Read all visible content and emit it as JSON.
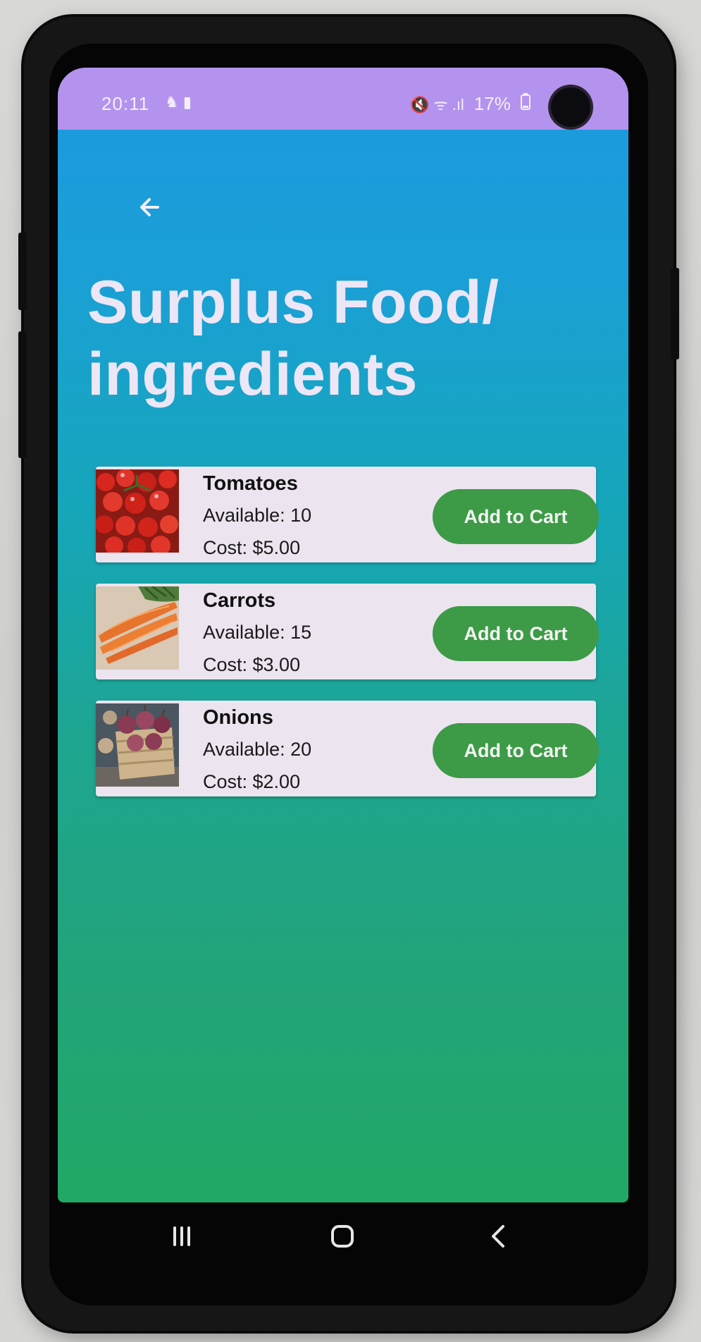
{
  "status_bar": {
    "time": "20:11",
    "left_icons": "♞ ▮",
    "right_icons": "🔇 ᯤ .ıl",
    "battery": "17%",
    "color": "#b493ee"
  },
  "header": {
    "back_icon": "arrow-left-icon",
    "title": "Surplus Food/ ingredients"
  },
  "items": [
    {
      "name": "Tomatoes",
      "available": "Available: 10",
      "cost": "Cost: $5.00",
      "button": "Add to Cart",
      "image": "tomatoes-photo"
    },
    {
      "name": "Carrots",
      "available": "Available: 15",
      "cost": "Cost: $3.00",
      "button": "Add to Cart",
      "image": "carrots-photo"
    },
    {
      "name": "Onions",
      "available": "Available: 20",
      "cost": "Cost: $2.00",
      "button": "Add to Cart",
      "image": "onions-photo"
    }
  ],
  "nav_bar": {
    "recents_icon": "recents-icon",
    "home_icon": "home-icon",
    "back_icon": "back-chevron-icon"
  },
  "colors": {
    "button_green": "#3d9a47",
    "card_bg": "#ece4ef",
    "gradient_top": "#1d98df",
    "gradient_bottom": "#21a865"
  }
}
